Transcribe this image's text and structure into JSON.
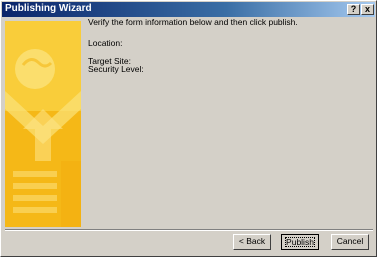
{
  "window": {
    "title": "Publishing Wizard",
    "help_label": "?",
    "close_label": "x"
  },
  "main": {
    "intro": "Verify the form information below and then click publish.",
    "location_label": "Location:",
    "target_site_label": "Target Site:",
    "security_level_label": "Security Level:"
  },
  "buttons": {
    "back": "< Back",
    "publish": "Publish",
    "cancel": "Cancel"
  },
  "colors": {
    "titlebar_start": "#0a246a",
    "titlebar_end": "#a6caf0",
    "art_primary": "#f7c21c",
    "art_accent": "#fbe27a"
  }
}
